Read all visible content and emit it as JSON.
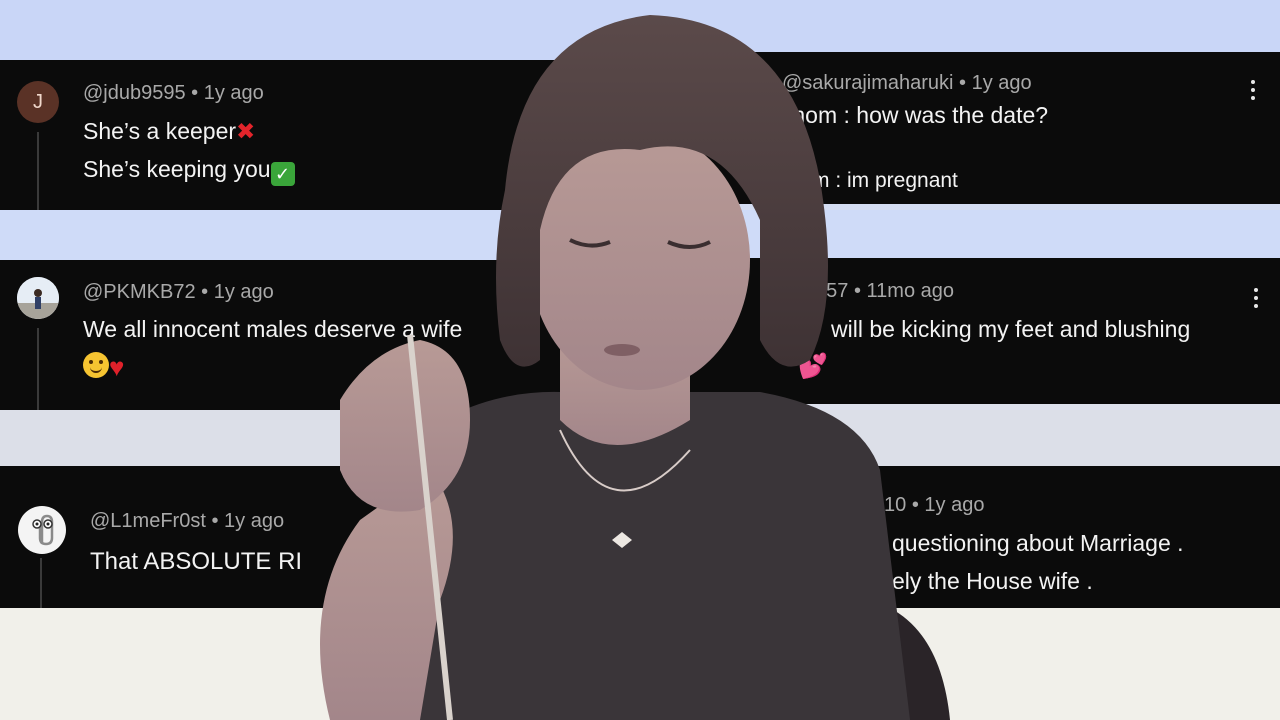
{
  "comments": [
    {
      "avatar_letter": "J",
      "avatar_color": "#5a3226",
      "handle": "@jdub9595",
      "time": "1y ago",
      "line1": "She’s a keeper",
      "line2": "She’s keeping you",
      "icons": [
        "cross-mark-icon",
        "check-mark-icon"
      ]
    },
    {
      "handle": "@sakurajimaharuki",
      "time": "1y ago",
      "line1": "mom : how was the date?",
      "line2": "m : im pregnant"
    },
    {
      "avatar_icon": "profile-photo-icon",
      "handle": "@PKMKB72",
      "time": "1y ago",
      "line1": "We all innocent males deserve a wife",
      "icons": [
        "smiling-face-icon",
        "heart-icon"
      ]
    },
    {
      "handle": "n57",
      "time": "11mo ago",
      "line1": "will be kicking my feet and blushing",
      "icons": [
        "two-hearts-icon"
      ]
    },
    {
      "avatar_icon": "paperclip-assistant-icon",
      "handle": "@L1meFr0st",
      "time": "1y ago",
      "line1": "That ABSOLUTE RI"
    },
    {
      "handle": "10",
      "time": "1y ago",
      "line1": "questioning about Marriage .",
      "line2": "ely the House wife ."
    }
  ],
  "separator": "•",
  "colors": {
    "card_bg": "#0b0b0b",
    "stripe_blue": "#c9d6f7",
    "meta_text": "#a9a9a9",
    "body_text": "#f3f3f3"
  }
}
